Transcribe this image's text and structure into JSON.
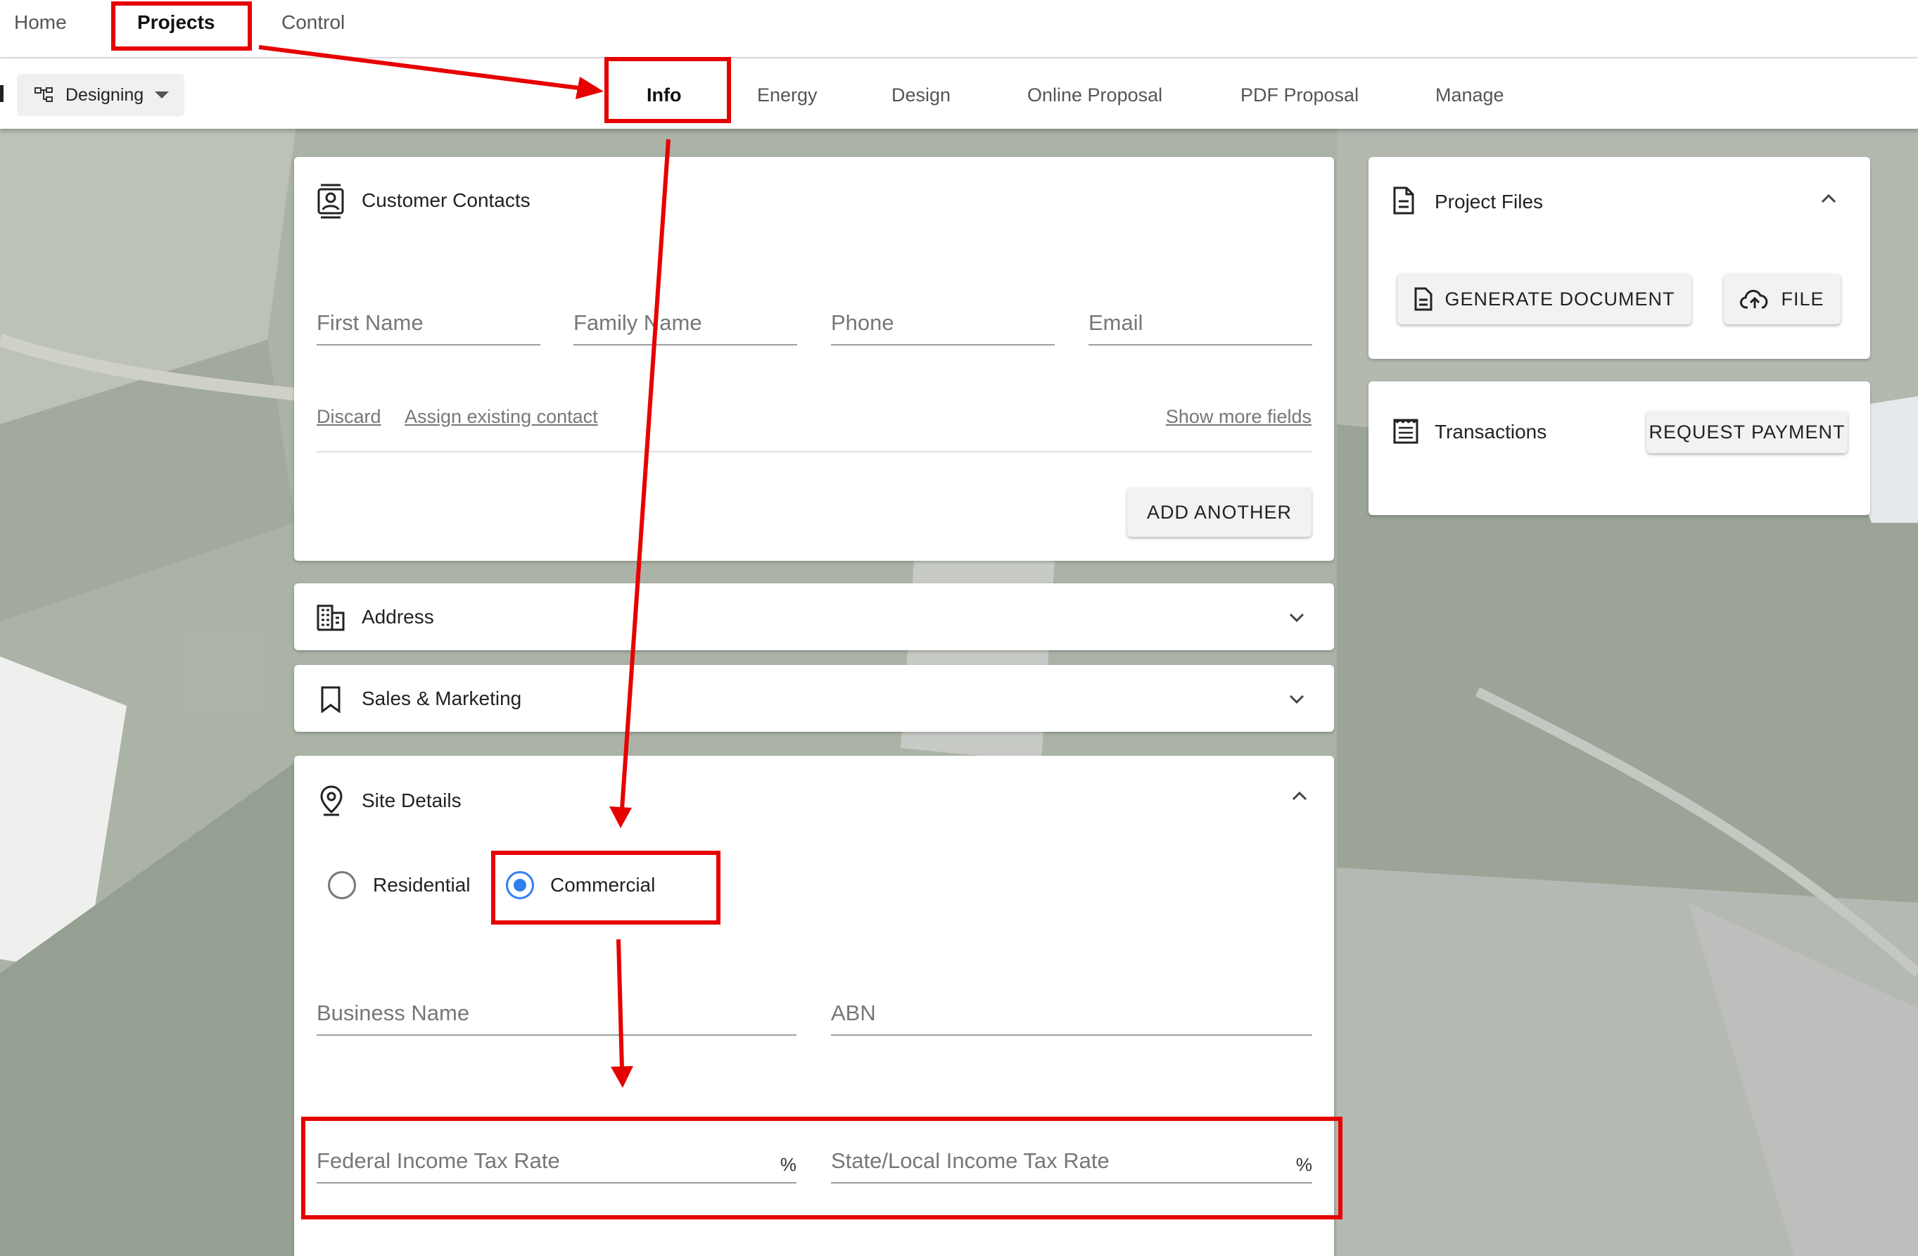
{
  "top_nav": {
    "home": "Home",
    "projects": "Projects",
    "control": "Control"
  },
  "sub_nav": {
    "status_label": "Designing",
    "tabs": [
      "Info",
      "Energy",
      "Design",
      "Online Proposal",
      "PDF Proposal",
      "Manage"
    ],
    "active_tab": "Info"
  },
  "customer_contacts": {
    "title": "Customer Contacts",
    "fields": {
      "first_name": "First Name",
      "family_name": "Family Name",
      "phone": "Phone",
      "email": "Email"
    },
    "links": {
      "discard": "Discard",
      "assign": "Assign existing contact",
      "more": "Show more fields"
    },
    "add_another": "ADD ANOTHER"
  },
  "address": {
    "title": "Address"
  },
  "sales_marketing": {
    "title": "Sales & Marketing"
  },
  "site_details": {
    "title": "Site Details",
    "property_type": {
      "options": [
        "Residential",
        "Commercial"
      ],
      "selected": "Commercial"
    },
    "fields": {
      "business_name": "Business Name",
      "abn": "ABN",
      "federal_tax": "Federal Income Tax Rate",
      "state_tax": "State/Local Income Tax Rate",
      "percent": "%"
    }
  },
  "project_files": {
    "title": "Project Files",
    "generate": "GENERATE DOCUMENT",
    "file": "FILE"
  },
  "transactions": {
    "title": "Transactions",
    "request_payment": "REQUEST PAYMENT"
  },
  "colors": {
    "annotation": "#e60000",
    "radio_selected": "#2f80ed"
  },
  "icons": [
    "hierarchy-icon",
    "contacts-icon",
    "building-icon",
    "bookmark-icon",
    "location-pin-icon",
    "document-icon",
    "cloud-upload-icon",
    "receipt-icon",
    "chevron-down-icon",
    "chevron-up-icon"
  ]
}
